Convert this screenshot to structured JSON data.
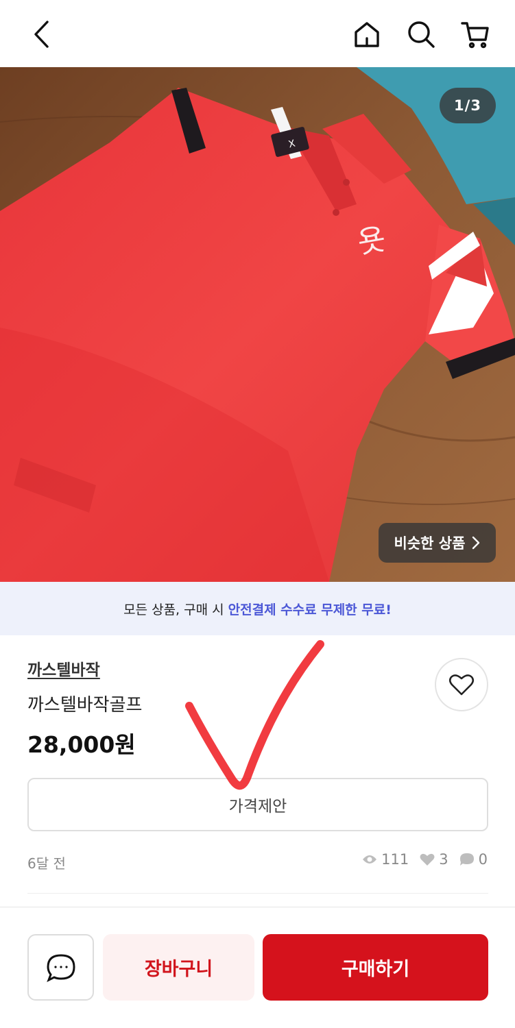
{
  "header": {
    "icons": [
      "back-icon",
      "home-icon",
      "search-icon",
      "cart-icon"
    ]
  },
  "gallery": {
    "counter": "1/3",
    "similar_label": "비슷한 상품",
    "colors": {
      "shirt": "#ee3b3b",
      "table": "#8a5532"
    }
  },
  "banner": {
    "text": "모든 상품, 구매 시",
    "highlight": "안전결제 수수료 무제한 무료!",
    "highlight_color": "#4b57d6"
  },
  "product": {
    "seller": "까스텔바작",
    "title": "까스텔바작골프",
    "price": "28,000원",
    "offer_label": "가격제안",
    "posted": "6달 전",
    "views": "111",
    "likes": "3",
    "chats": "0"
  },
  "bottom_bar": {
    "cart_label": "장바구니",
    "buy_label": "구매하기",
    "accent": "#d5121c"
  }
}
